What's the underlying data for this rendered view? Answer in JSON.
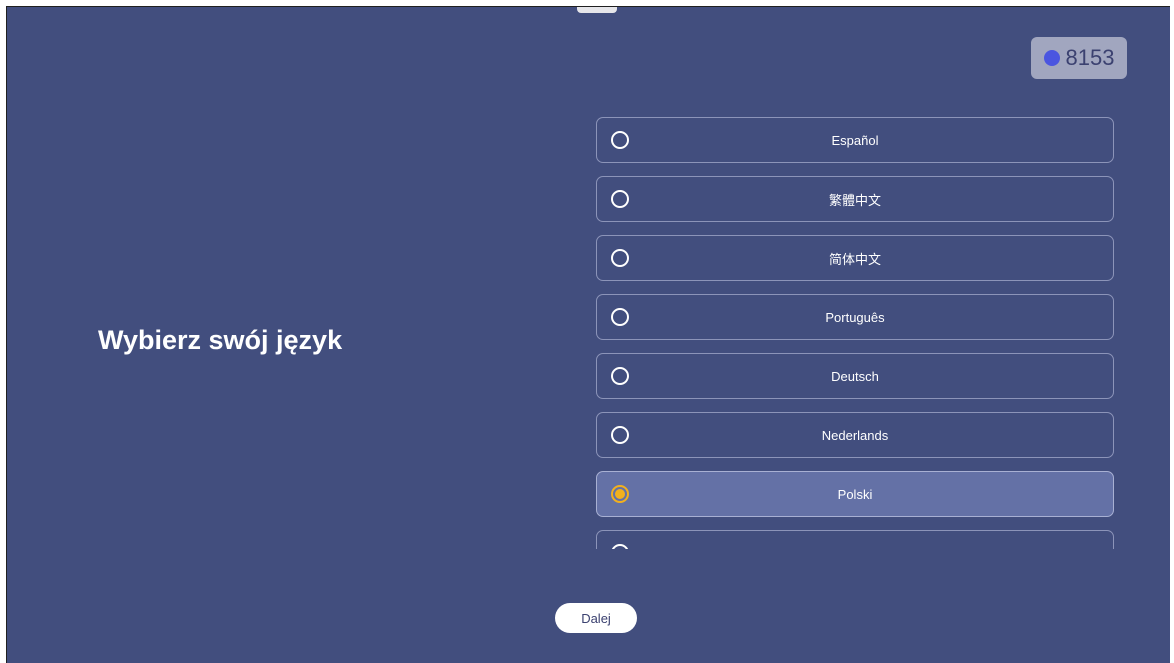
{
  "counter": {
    "value": "8153",
    "dot_color": "#4a55e0"
  },
  "title": "Wybierz swój język",
  "languages": [
    {
      "label": "Español",
      "selected": false
    },
    {
      "label": "繁體中文",
      "selected": false
    },
    {
      "label": "简体中文",
      "selected": false
    },
    {
      "label": "Português",
      "selected": false
    },
    {
      "label": "Deutsch",
      "selected": false
    },
    {
      "label": "Nederlands",
      "selected": false
    },
    {
      "label": "Polski",
      "selected": true
    },
    {
      "label": "",
      "selected": false
    }
  ],
  "next_label": "Dalej",
  "colors": {
    "background": "#424e7e",
    "accent": "#f2b01e",
    "selected_row": "#6471a6"
  }
}
